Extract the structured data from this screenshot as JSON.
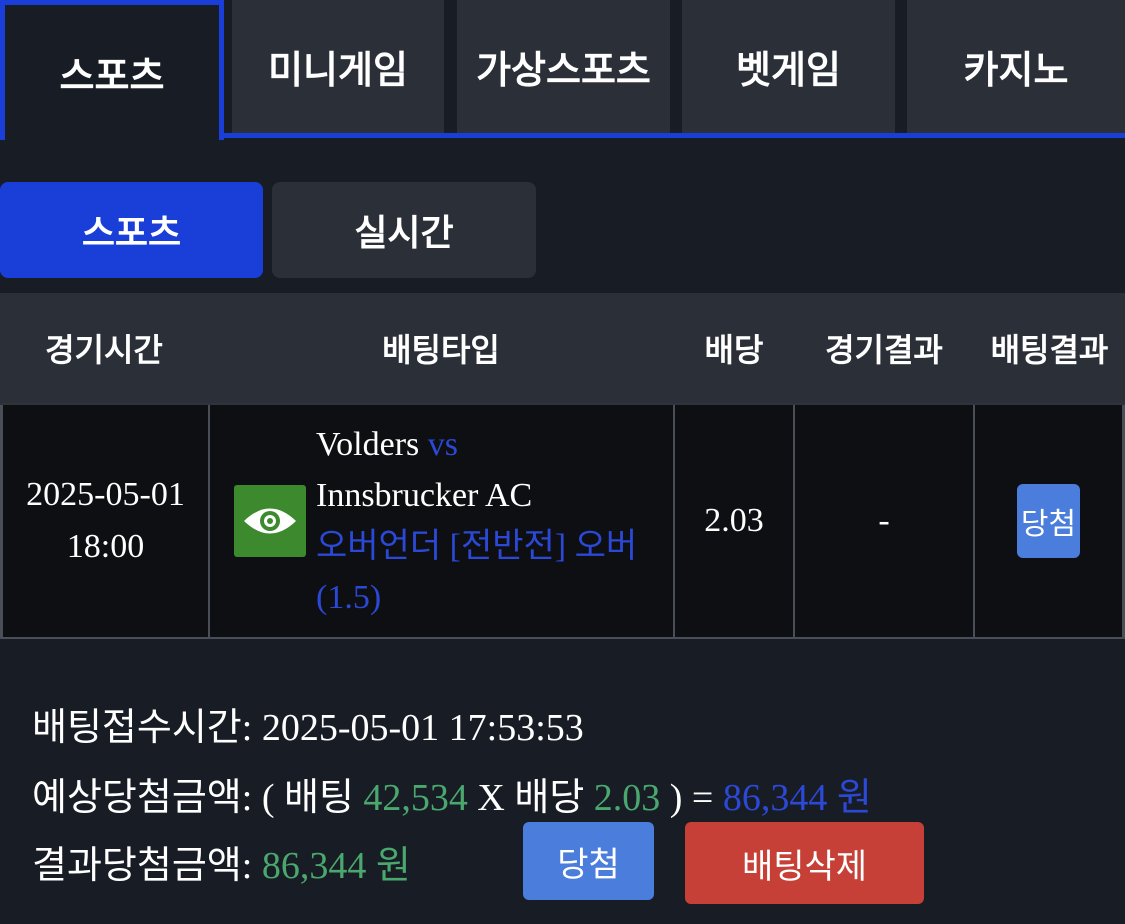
{
  "top_tabs": [
    "스포츠",
    "미니게임",
    "가상스포츠",
    "벳게임",
    "카지노"
  ],
  "sub_tabs": [
    "스포츠",
    "실시간"
  ],
  "table": {
    "headers": [
      "경기시간",
      "배팅타입",
      "배당",
      "경기결과",
      "배팅결과"
    ],
    "row": {
      "date": "2025-05-01",
      "time": "18:00",
      "home_team": "Volders",
      "vs": "vs",
      "away_team": "Innsbrucker AC",
      "bet_type_line1": "오버언더 [전반전] 오버",
      "bet_type_line2": "(1.5)",
      "odds": "2.03",
      "game_result": "-",
      "bet_result": "당첨",
      "icon": "eye-icon"
    }
  },
  "summary": {
    "accept_label": "배팅접수시간:",
    "accept_time": "2025-05-01 17:53:53",
    "expected_label": "예상당첨금액:",
    "open_paren": "(",
    "bet_word": "배팅",
    "bet_amount": "42,534",
    "times": "X",
    "odds_word": "배당",
    "odds_value": "2.03",
    "close_paren_eq": ") =",
    "expected_amount": "86,344 원",
    "result_label": "결과당첨금액:",
    "result_amount": "86,344 원",
    "win_button": "당첨",
    "delete_button": "배팅삭제"
  },
  "colors": {
    "accent": "#1a3fd9",
    "win": "#4a7ddc",
    "delete": "#c64037",
    "money_green": "#4aa86e"
  }
}
